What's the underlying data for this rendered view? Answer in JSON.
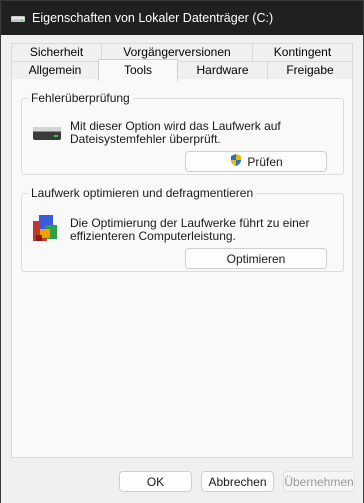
{
  "window": {
    "title": "Eigenschaften von Lokaler Datenträger (C:)",
    "titlebar_color": "#202020"
  },
  "tabs": {
    "row_top": [
      "Sicherheit",
      "Vorgängerversionen",
      "Kontingent"
    ],
    "row_bottom": [
      "Allgemein",
      "Tools",
      "Hardware",
      "Freigabe"
    ],
    "active": "Tools"
  },
  "error_check": {
    "title": "Fehlerüberprüfung",
    "description_line1": "Mit dieser Option wird das Laufwerk auf",
    "description_line2": "Dateisystemfehler überprüft.",
    "button": "Prüfen",
    "icon": "drive-icon"
  },
  "optimize": {
    "title": "Laufwerk optimieren und defragmentieren",
    "description_line1": "Die Optimierung der Laufwerke führt zu einer",
    "description_line2": "effizienteren Computerleistung.",
    "button": "Optimieren",
    "icon": "defrag-icon"
  },
  "footer": {
    "ok": "OK",
    "cancel": "Abbrechen",
    "apply": "Übernehmen",
    "accent_color": "#005fb8"
  }
}
